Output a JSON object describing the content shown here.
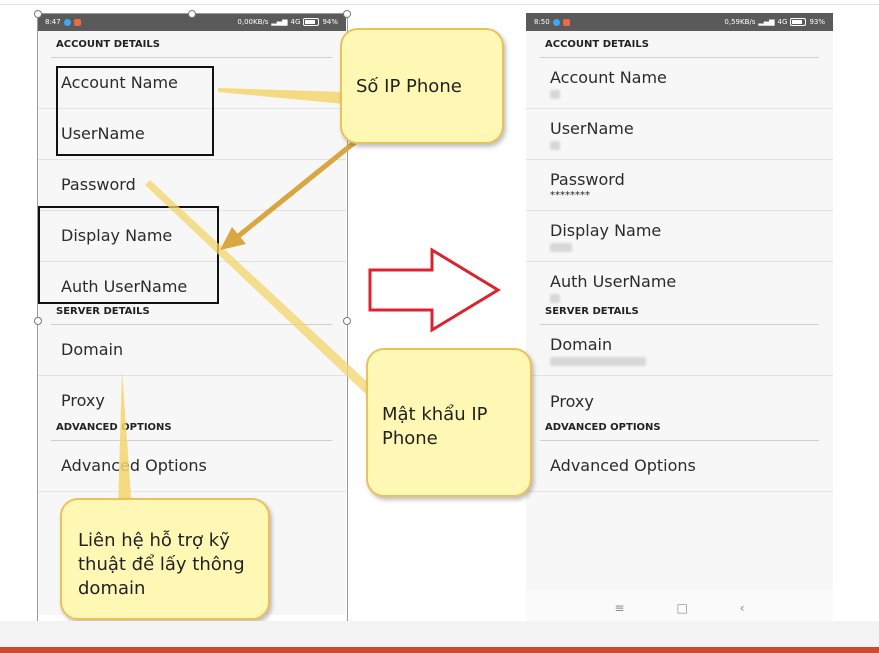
{
  "left_phone": {
    "status": {
      "time": "8:47",
      "speed": "0,00KB/s",
      "network": "4G",
      "battery": "94%"
    },
    "sections": {
      "account": "ACCOUNT DETAILS",
      "server": "SERVER DETAILS",
      "advanced": "ADVANCED OPTIONS"
    },
    "rows": {
      "account_name": "Account Name",
      "username": "UserName",
      "password": "Password",
      "display_name": "Display Name",
      "auth_username": "Auth UserName",
      "domain": "Domain",
      "proxy": "Proxy",
      "advanced_options": "Advanced Options"
    }
  },
  "right_phone": {
    "status": {
      "time": "8:50",
      "speed": "0,59KB/s",
      "network": "4G",
      "battery": "93%"
    },
    "sections": {
      "account": "ACCOUNT DETAILS",
      "server": "SERVER DETAILS",
      "advanced": "ADVANCED OPTIONS"
    },
    "rows": {
      "account_name": "Account Name",
      "username": "UserName",
      "password": "Password",
      "password_value": "********",
      "display_name": "Display Name",
      "auth_username": "Auth UserName",
      "domain": "Domain",
      "proxy": "Proxy",
      "advanced_options": "Advanced Options"
    },
    "nav": {
      "menu": "≡",
      "home": "□",
      "back": "‹"
    }
  },
  "callouts": {
    "ip_phone_number": "Số IP Phone",
    "ip_phone_password_line1": "Mật khẩu IP",
    "ip_phone_password_line2": "Phone",
    "domain_support_line1": "Liên hệ hỗ trợ kỹ",
    "domain_support_line2": "thuật để lấy thông",
    "domain_support_line3": "domain"
  },
  "colors": {
    "callout_fill": "#fff8b5",
    "callout_border": "#e9c25c",
    "arrow_red": "#d9232e",
    "arrow_gold": "#d9a640"
  }
}
